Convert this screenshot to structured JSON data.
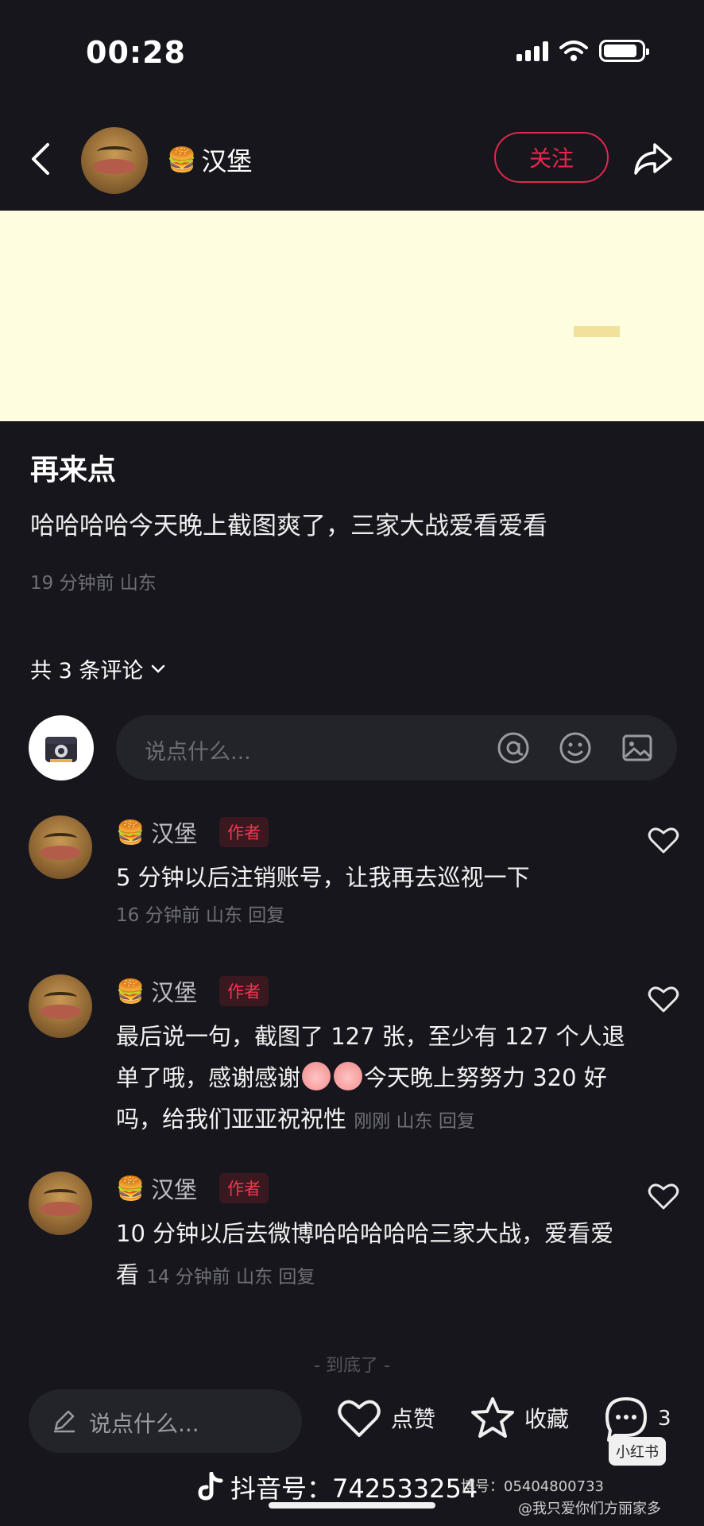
{
  "status_bar": {
    "time": "00:28",
    "battery_level": 0.9
  },
  "header": {
    "username": "汉堡",
    "username_emoji": "🍔",
    "follow_label": "关注",
    "icons": {
      "back": "back-chevron-icon",
      "share": "share-arrow-icon"
    }
  },
  "post": {
    "title": "再来点",
    "body": "哈哈哈哈今天晚上截图爽了，三家大战爱看爱看",
    "meta": "19 分钟前 山东"
  },
  "comments_section": {
    "count_label": "共 3 条评论",
    "input_placeholder": "说点什么...",
    "input_icons": [
      "at-icon",
      "emoji-icon",
      "image-icon"
    ]
  },
  "comments": [
    {
      "username": "汉堡",
      "emoji": "🍔",
      "tag": "作者",
      "text": "5 分钟以后注销账号，让我再去巡视一下",
      "meta": "16 分钟前 山东 回复"
    },
    {
      "username": "汉堡",
      "emoji": "🍔",
      "tag": "作者",
      "text_part1": "最后说一句，截图了 127 张，至少有 127 个人退单了哦，感谢感谢",
      "text_part2": "今天晚上努努力 320 好吗，给我们亚亚祝祝性",
      "meta": "刚刚 山东 回复"
    },
    {
      "username": "汉堡",
      "emoji": "🍔",
      "tag": "作者",
      "text": "10 分钟以后去微博哈哈哈哈哈三家大战，爱看爱看",
      "meta": "14 分钟前 山东 回复"
    }
  ],
  "end_marker": "- 到底了 -",
  "bottom_bar": {
    "input_placeholder": "说点什么...",
    "like_label": "点赞",
    "favorite_label": "收藏",
    "comment_count": "3"
  },
  "watermark": {
    "douyin_id": "抖音号：742533254",
    "weibo_text": "博号：05404800733",
    "weibo_user": "@我只爱你们方丽家多",
    "badge": "小红书"
  },
  "colors": {
    "accent": "#e6264c",
    "background": "#16161c",
    "banner": "#fefddf"
  }
}
